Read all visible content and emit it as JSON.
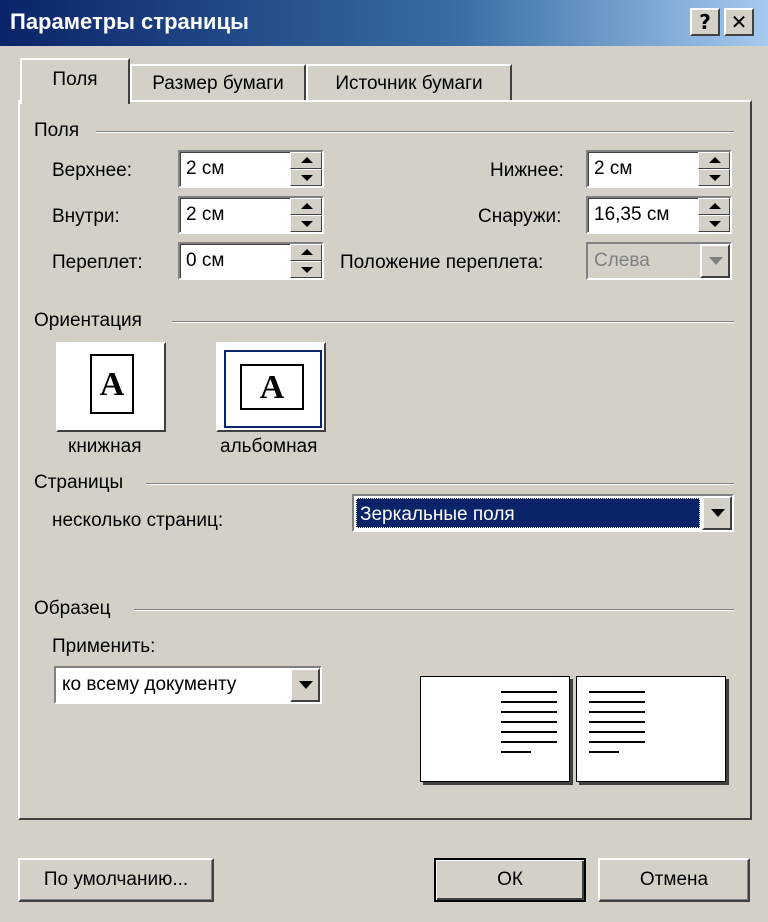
{
  "window": {
    "title": "Параметры страницы",
    "help_button": "?",
    "close_button": "✕"
  },
  "tabs": [
    {
      "label": "Поля",
      "active": true
    },
    {
      "label": "Размер бумаги",
      "active": false
    },
    {
      "label": "Источник бумаги",
      "active": false
    }
  ],
  "margins": {
    "group_label": "Поля",
    "top_label": "Верхнее:",
    "top_value": "2 см",
    "bottom_label": "Нижнее:",
    "bottom_value": "2 см",
    "inside_label": "Внутри:",
    "inside_value": "2 см",
    "outside_label": "Снаружи:",
    "outside_value": "16,35 см",
    "gutter_label": "Переплет:",
    "gutter_value": "0 см",
    "gutter_pos_label": "Положение переплета:",
    "gutter_pos_value": "Слева"
  },
  "orientation": {
    "group_label": "Ориентация",
    "icon_letter": "A",
    "portrait_label": "книжная",
    "landscape_label": "альбомная",
    "selected": "landscape"
  },
  "pages": {
    "group_label": "Страницы",
    "multiple_label": "несколько страниц:",
    "multiple_value": "Зеркальные поля"
  },
  "sample": {
    "group_label": "Образец",
    "apply_label": "Применить:",
    "apply_value": "ко всему документу"
  },
  "buttons": {
    "default_label": "По умолчанию...",
    "ok_label": "ОК",
    "cancel_label": "Отмена"
  },
  "colors": {
    "title_bar": "#0a246a",
    "dialog_bg": "#d4d0c8",
    "selection": "#0a246a"
  }
}
